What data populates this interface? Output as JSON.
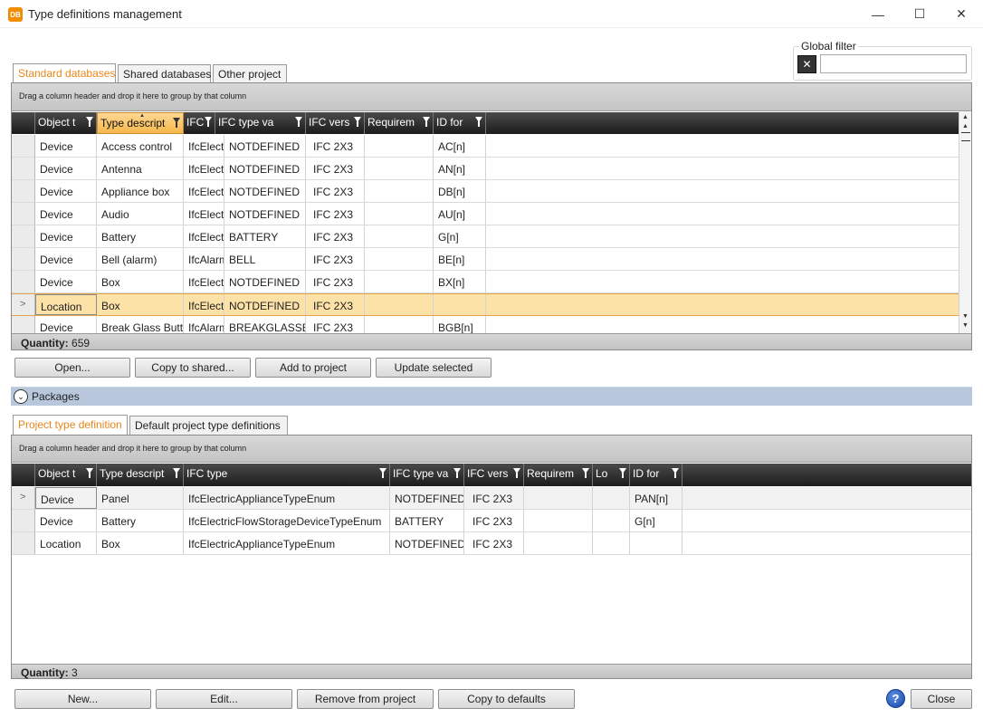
{
  "window": {
    "app_icon_text": "DB",
    "title": "Type definitions management",
    "minimize": "—",
    "maximize": "☐",
    "close": "✕"
  },
  "top_tabs": [
    "Standard databases",
    "Shared databases",
    "Other project"
  ],
  "global_filter": {
    "label": "Global filter",
    "clear_icon": "✕",
    "value": "",
    "placeholder": ""
  },
  "top_grid": {
    "group_hint": "Drag a column header and drop it here to group by that column",
    "columns": [
      "Object t",
      "Type descript",
      "IFC t",
      "IFC type va",
      "IFC vers",
      "Requirem",
      "ID for"
    ],
    "rows": [
      {
        "marker": "",
        "cells": [
          "Device",
          "Access control",
          "IfcElectr",
          "NOTDEFINED",
          "IFC 2X3",
          "",
          "AC[n]"
        ]
      },
      {
        "marker": "",
        "cells": [
          "Device",
          "Antenna",
          "IfcElectr",
          "NOTDEFINED",
          "IFC 2X3",
          "",
          "AN[n]"
        ]
      },
      {
        "marker": "",
        "cells": [
          "Device",
          "Appliance box",
          "IfcElectr",
          "NOTDEFINED",
          "IFC 2X3",
          "",
          "DB[n]"
        ]
      },
      {
        "marker": "",
        "cells": [
          "Device",
          "Audio",
          "IfcElectr",
          "NOTDEFINED",
          "IFC 2X3",
          "",
          "AU[n]"
        ]
      },
      {
        "marker": "",
        "cells": [
          "Device",
          "Battery",
          "IfcElectr",
          "BATTERY",
          "IFC 2X3",
          "",
          "G[n]"
        ]
      },
      {
        "marker": "",
        "cells": [
          "Device",
          "Bell (alarm)",
          "IfcAlarm",
          "BELL",
          "IFC 2X3",
          "",
          "BE[n]"
        ]
      },
      {
        "marker": "",
        "cells": [
          "Device",
          "Box",
          "IfcElectr",
          "NOTDEFINED",
          "IFC 2X3",
          "",
          "BX[n]"
        ]
      },
      {
        "marker": ">",
        "cells": [
          "Location",
          "Box",
          "IfcElectr",
          "NOTDEFINED",
          "IFC 2X3",
          "",
          ""
        ]
      },
      {
        "marker": "",
        "cells": [
          "Device",
          "Break Glass Butt",
          "IfcAlarm",
          "BREAKGLASSB",
          "IFC 2X3",
          "",
          "BGB[n]"
        ]
      }
    ],
    "quantity_label": "Quantity:",
    "quantity_value": "659"
  },
  "top_buttons": [
    "Open...",
    "Copy to shared...",
    "Add to project",
    "Update selected"
  ],
  "packages": {
    "label": "Packages",
    "icon": "⌄"
  },
  "bottom_tabs": [
    "Project type definition",
    "Default project type definitions"
  ],
  "bottom_grid": {
    "group_hint": "Drag a column header and drop it here to group by that column",
    "columns": [
      "Object t",
      "Type descript",
      "IFC type",
      "IFC type va",
      "IFC vers",
      "Requirem",
      "Lo",
      "ID for"
    ],
    "rows": [
      {
        "marker": ">",
        "cells": [
          "Device",
          "Panel",
          "IfcElectricApplianceTypeEnum",
          "NOTDEFINED",
          "IFC 2X3",
          "",
          "",
          "PAN[n]"
        ]
      },
      {
        "marker": "",
        "cells": [
          "Device",
          "Battery",
          "IfcElectricFlowStorageDeviceTypeEnum",
          "BATTERY",
          "IFC 2X3",
          "",
          "",
          "G[n]"
        ]
      },
      {
        "marker": "",
        "cells": [
          "Location",
          "Box",
          "IfcElectricApplianceTypeEnum",
          "NOTDEFINED",
          "IFC 2X3",
          "",
          "",
          ""
        ]
      }
    ],
    "quantity_label": "Quantity:",
    "quantity_value": "3"
  },
  "bottom_buttons": [
    "New...",
    "Edit...",
    "Remove from project",
    "Copy to defaults"
  ],
  "help_icon": "?",
  "close_button": "Close",
  "colors": {
    "accent": "#e8861a",
    "selected_row": "#fde2a8",
    "header_dark": "#2a2a2a",
    "packages_bar": "#b8c7dc"
  }
}
